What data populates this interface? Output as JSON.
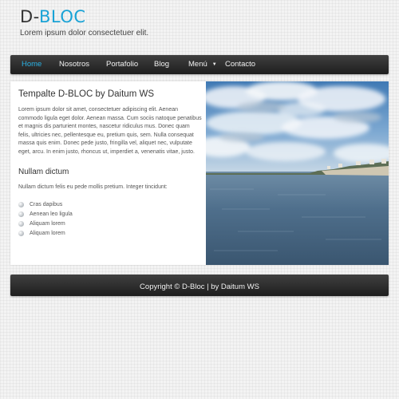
{
  "header": {
    "logo_prefix": "D-",
    "logo_accent": "BLOC",
    "tagline": "Lorem ipsum dolor consectetuer elit."
  },
  "nav": {
    "items": [
      {
        "label": "Home",
        "active": true
      },
      {
        "label": "Nosotros"
      },
      {
        "label": "Portafolio"
      },
      {
        "label": "Blog"
      },
      {
        "label": "Menú",
        "dropdown": true,
        "arrow": "▼"
      },
      {
        "label": "Contacto"
      }
    ]
  },
  "main": {
    "title": "Tempalte D-BLOC by Daitum WS",
    "body": "Lorem ipsum dolor sit amet, consectetuer adipiscing elit. Aenean commodo ligula eget dolor. Aenean massa. Cum sociis natoque penatibus et magnis dis parturient montes, nascetur ridiculus mus. Donec quam felis, ultricies nec, pellentesque eu, pretium quis, sem. Nulla consequat massa quis enim. Donec pede justo, fringilla vel, aliquet nec, vulputate eget, arcu. In enim justo, rhoncus ut, imperdiet a, venenatis vitae, justo.",
    "section_title": "Nullam dictum",
    "section_body": "Nullam dictum felis eu pede mollis pretium. Integer tincidunt:",
    "bullets": [
      "Cras dapibus",
      "Aenean leo ligula",
      "Aliquam lorem",
      "Aliquam lorem"
    ]
  },
  "footer": {
    "text": "Copyright © D-Bloc | by Daitum WS"
  },
  "colors": {
    "accent": "#1aa3d6",
    "bar_dark": "#1e1e1e",
    "background": "#f3f3f3"
  }
}
